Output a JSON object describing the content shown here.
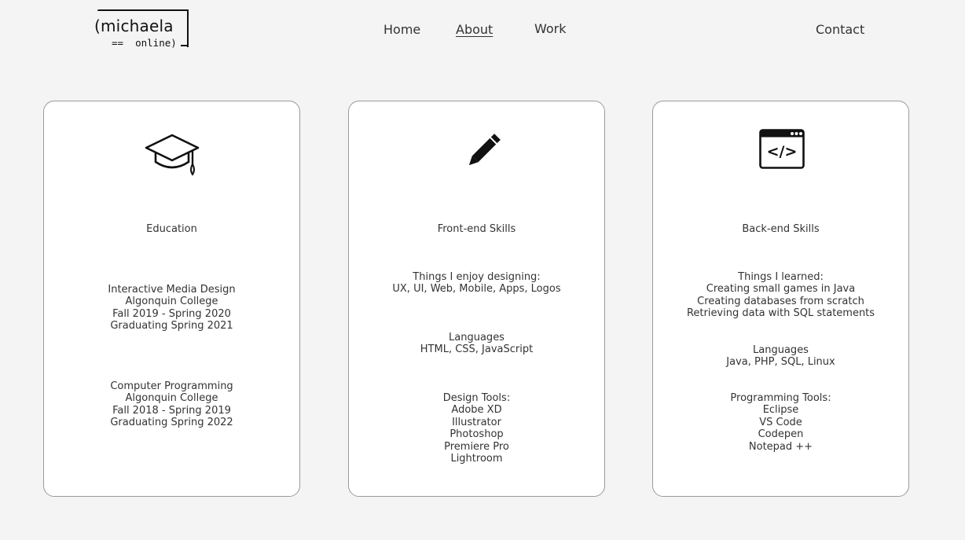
{
  "logo": {
    "main": "(michaela",
    "sub": "==  online)"
  },
  "nav": {
    "home": "Home",
    "about": "About",
    "work": "Work",
    "contact": "Contact"
  },
  "cards": [
    {
      "icon": "graduation-cap-icon",
      "title": "Education",
      "blocks": [
        [
          "Interactive Media Design",
          "Algonquin College",
          "Fall 2019 - Spring 2020",
          "Graduating Spring 2021"
        ],
        [
          "Computer Programming",
          "Algonquin College",
          "Fall 2018 - Spring 2019",
          "Graduating Spring 2022"
        ]
      ]
    },
    {
      "icon": "pencil-icon",
      "title": "Front-end Skills",
      "blocks": [
        [
          "Things I enjoy designing:",
          "UX, UI, Web, Mobile, Apps, Logos"
        ],
        [
          "Languages",
          "HTML, CSS, JavaScript"
        ],
        [
          "Design Tools:",
          "Adobe XD",
          "Illustrator",
          "Photoshop",
          "Premiere Pro",
          "Lightroom"
        ]
      ]
    },
    {
      "icon": "code-window-icon",
      "title": "Back-end Skills",
      "blocks": [
        [
          "Things I learned:",
          "Creating small games in Java",
          "Creating databases from scratch",
          "Retrieving data with SQL statements"
        ],
        [
          "Languages",
          "Java, PHP, SQL, Linux"
        ],
        [
          "Programming Tools:",
          "Eclipse",
          "VS Code",
          "Codepen",
          "Notepad ++"
        ]
      ]
    }
  ]
}
